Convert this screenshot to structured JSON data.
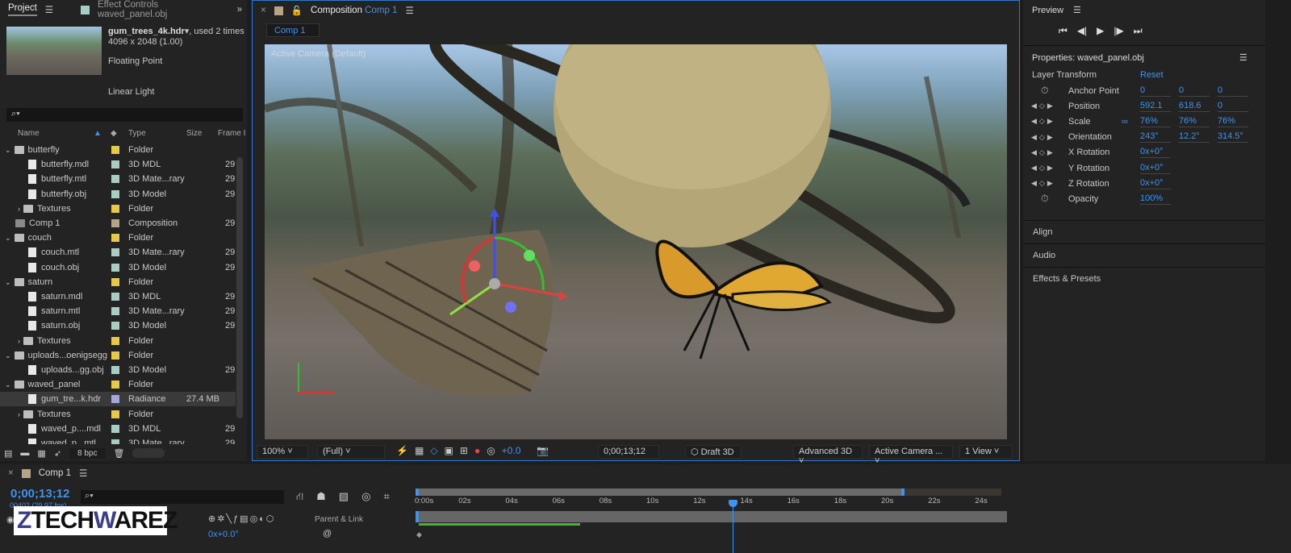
{
  "project": {
    "tab_label": "Project",
    "effect_controls_tab": "Effect Controls waved_panel.obj",
    "footage_name": "gum_trees_4k.hdr",
    "footage_used": ", used 2 times",
    "footage_dims": "4096 x 2048 (1.00)",
    "footage_depth": "Floating Point",
    "footage_color": "Linear Light",
    "columns": {
      "name": "Name",
      "type": "Type",
      "size": "Size",
      "frame": "Frame I"
    },
    "items": [
      {
        "name": "butterfly",
        "kind": "folder",
        "indent": 0,
        "expanded": true,
        "label": "#e6c84a",
        "type": "Folder",
        "size": "",
        "frame": ""
      },
      {
        "name": "butterfly.mdl",
        "kind": "doc",
        "indent": 1,
        "label": "#a9cdc5",
        "type": "3D MDL",
        "size": "",
        "frame": "29"
      },
      {
        "name": "butterfly.mtl",
        "kind": "doc3d",
        "indent": 1,
        "label": "#a9cdc5",
        "type": "3D Mate...rary",
        "size": "",
        "frame": "29"
      },
      {
        "name": "butterfly.obj",
        "kind": "doc3d",
        "indent": 1,
        "label": "#a9cdc5",
        "type": "3D Model",
        "size": "",
        "frame": "29"
      },
      {
        "name": "Textures",
        "kind": "folder",
        "indent": 1,
        "expanded": false,
        "label": "#e6c84a",
        "type": "Folder",
        "size": "",
        "frame": ""
      },
      {
        "name": "Comp 1",
        "kind": "comp",
        "indent": 0,
        "label": "#b5a485",
        "type": "Composition",
        "size": "",
        "frame": "29"
      },
      {
        "name": "couch",
        "kind": "folder",
        "indent": 0,
        "expanded": true,
        "label": "#e6c84a",
        "type": "Folder",
        "size": "",
        "frame": ""
      },
      {
        "name": "couch.mtl",
        "kind": "doc3d",
        "indent": 1,
        "label": "#a9cdc5",
        "type": "3D Mate...rary",
        "size": "",
        "frame": "29"
      },
      {
        "name": "couch.obj",
        "kind": "doc3d",
        "indent": 1,
        "label": "#a9cdc5",
        "type": "3D Model",
        "size": "",
        "frame": "29"
      },
      {
        "name": "saturn",
        "kind": "folder",
        "indent": 0,
        "expanded": true,
        "label": "#e6c84a",
        "type": "Folder",
        "size": "",
        "frame": ""
      },
      {
        "name": "saturn.mdl",
        "kind": "doc",
        "indent": 1,
        "label": "#a9cdc5",
        "type": "3D MDL",
        "size": "",
        "frame": "29"
      },
      {
        "name": "saturn.mtl",
        "kind": "doc3d",
        "indent": 1,
        "label": "#a9cdc5",
        "type": "3D Mate...rary",
        "size": "",
        "frame": "29"
      },
      {
        "name": "saturn.obj",
        "kind": "doc3d",
        "indent": 1,
        "label": "#a9cdc5",
        "type": "3D Model",
        "size": "",
        "frame": "29"
      },
      {
        "name": "Textures",
        "kind": "folder",
        "indent": 1,
        "expanded": false,
        "label": "#e6c84a",
        "type": "Folder",
        "size": "",
        "frame": ""
      },
      {
        "name": "uploads...oenigsegg",
        "kind": "folder",
        "indent": 0,
        "expanded": true,
        "label": "#e6c84a",
        "type": "Folder",
        "size": "",
        "frame": ""
      },
      {
        "name": "uploads...gg.obj",
        "kind": "doc3d",
        "indent": 1,
        "label": "#a9cdc5",
        "type": "3D Model",
        "size": "",
        "frame": "29"
      },
      {
        "name": "waved_panel",
        "kind": "folder",
        "indent": 0,
        "expanded": true,
        "label": "#e6c84a",
        "type": "Folder",
        "size": "",
        "frame": ""
      },
      {
        "name": "gum_tre...k.hdr",
        "kind": "doc3d",
        "indent": 1,
        "label": "#a6a6d8",
        "type": "Radiance",
        "size": "27.4 MB",
        "frame": "",
        "selected": true
      },
      {
        "name": "Textures",
        "kind": "folder",
        "indent": 1,
        "expanded": false,
        "label": "#e6c84a",
        "type": "Folder",
        "size": "",
        "frame": ""
      },
      {
        "name": "waved_p....mdl",
        "kind": "doc",
        "indent": 1,
        "label": "#a9cdc5",
        "type": "3D MDL",
        "size": "",
        "frame": "29"
      },
      {
        "name": "waved_p...mtl",
        "kind": "doc3d",
        "indent": 1,
        "label": "#a9cdc5",
        "type": "3D Mate...rary",
        "size": "",
        "frame": "29"
      }
    ],
    "bpc": "8 bpc"
  },
  "composition": {
    "tab_prefix": "Composition",
    "tab_name": "Comp 1",
    "subtab": "Comp 1",
    "camera_label": "Active Camera (Default)",
    "zoom": "100%",
    "resolution": "(Full)",
    "exposure": "+0.0",
    "timecode": "0;00;13;12",
    "renderer_button": "Draft 3D",
    "renderer": "Advanced 3D",
    "camera": "Active Camera ...",
    "views": "1 View"
  },
  "preview": {
    "title": "Preview"
  },
  "properties": {
    "title": "Properties: waved_panel.obj",
    "section": "Layer Transform",
    "reset": "Reset",
    "rows": [
      {
        "label": "Anchor Point",
        "values": [
          "0",
          "0",
          "0"
        ],
        "stopwatch": true
      },
      {
        "label": "Position",
        "values": [
          "592.1",
          "618.6",
          "0"
        ]
      },
      {
        "label": "Scale",
        "values": [
          "76%",
          "76%",
          "76%"
        ],
        "link": true
      },
      {
        "label": "Orientation",
        "values": [
          "243°",
          "12.2°",
          "314.5°"
        ]
      },
      {
        "label": "X Rotation",
        "values": [
          "0x+0°"
        ]
      },
      {
        "label": "Y Rotation",
        "values": [
          "0x+0°"
        ]
      },
      {
        "label": "Z Rotation",
        "values": [
          "0x+0°"
        ]
      },
      {
        "label": "Opacity",
        "values": [
          "100%"
        ],
        "stopwatch": true
      }
    ],
    "sections": [
      "Align",
      "Audio",
      "Effects & Presets"
    ]
  },
  "timeline": {
    "tab": "Comp 1",
    "timecode": "0;00;13;12",
    "frame_info": "00402 (29.97 fps)",
    "parent_link": "Parent & Link",
    "layer_value": "0x+0.0°",
    "ticks": [
      "0:00s",
      "02s",
      "04s",
      "06s",
      "08s",
      "10s",
      "12s",
      "14s",
      "16s",
      "18s",
      "20s",
      "22s",
      "24s"
    ],
    "playhead_seconds": 13.4,
    "work_area_end_seconds": 20.7
  },
  "watermark": "ZTECHWAREZ"
}
